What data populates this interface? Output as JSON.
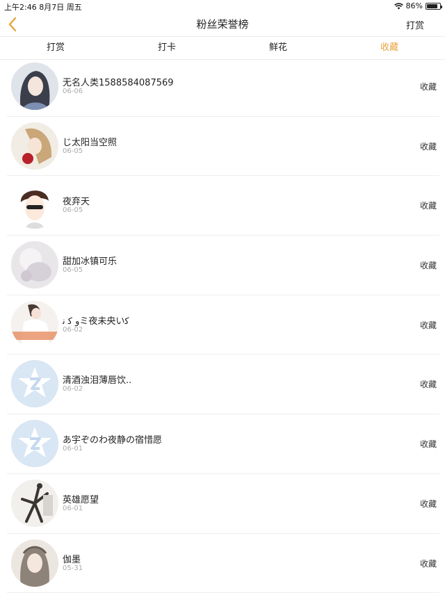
{
  "status_bar": {
    "time_date": "上午2:46  8月7日 周五",
    "battery_text": "86%",
    "battery_level": 0.86
  },
  "nav": {
    "title": "粉丝荣誉榜",
    "action_label": "打赏"
  },
  "tabs": [
    {
      "label": "打赏",
      "active": false
    },
    {
      "label": "打卡",
      "active": false
    },
    {
      "label": "鲜花",
      "active": false
    },
    {
      "label": "收藏",
      "active": true
    }
  ],
  "colors": {
    "accent": "#e8a33d"
  },
  "rows": [
    {
      "name": "无名人类1588584087569",
      "date": "06-06",
      "action": "收藏",
      "avatar": "anime-portrait"
    },
    {
      "name": "じ太阳当空照",
      "date": "06-05",
      "action": "收藏",
      "avatar": "girl-with-rose"
    },
    {
      "name": "夜弃天",
      "date": "06-05",
      "action": "收藏",
      "avatar": "boy-sunglasses"
    },
    {
      "name": "甜加冰镇可乐",
      "date": "06-05",
      "action": "收藏",
      "avatar": "soft-white"
    },
    {
      "name": "ﻭ ﮐ ﻧミ夜未央いﮐ",
      "date": "06-02",
      "action": "收藏",
      "avatar": "girl-white-top"
    },
    {
      "name": "清酒浊泪薄唇饮..",
      "date": "06-02",
      "action": "收藏",
      "avatar": "default-qzone"
    },
    {
      "name": "あ宇ぞのわ夜静の宿惜愿",
      "date": "06-01",
      "action": "收藏",
      "avatar": "default-qzone"
    },
    {
      "name": "英雄愿望",
      "date": "06-01",
      "action": "收藏",
      "avatar": "dancer-silhouette"
    },
    {
      "name": "伽墨",
      "date": "05-31",
      "action": "收藏",
      "avatar": "veiled-girl"
    }
  ]
}
